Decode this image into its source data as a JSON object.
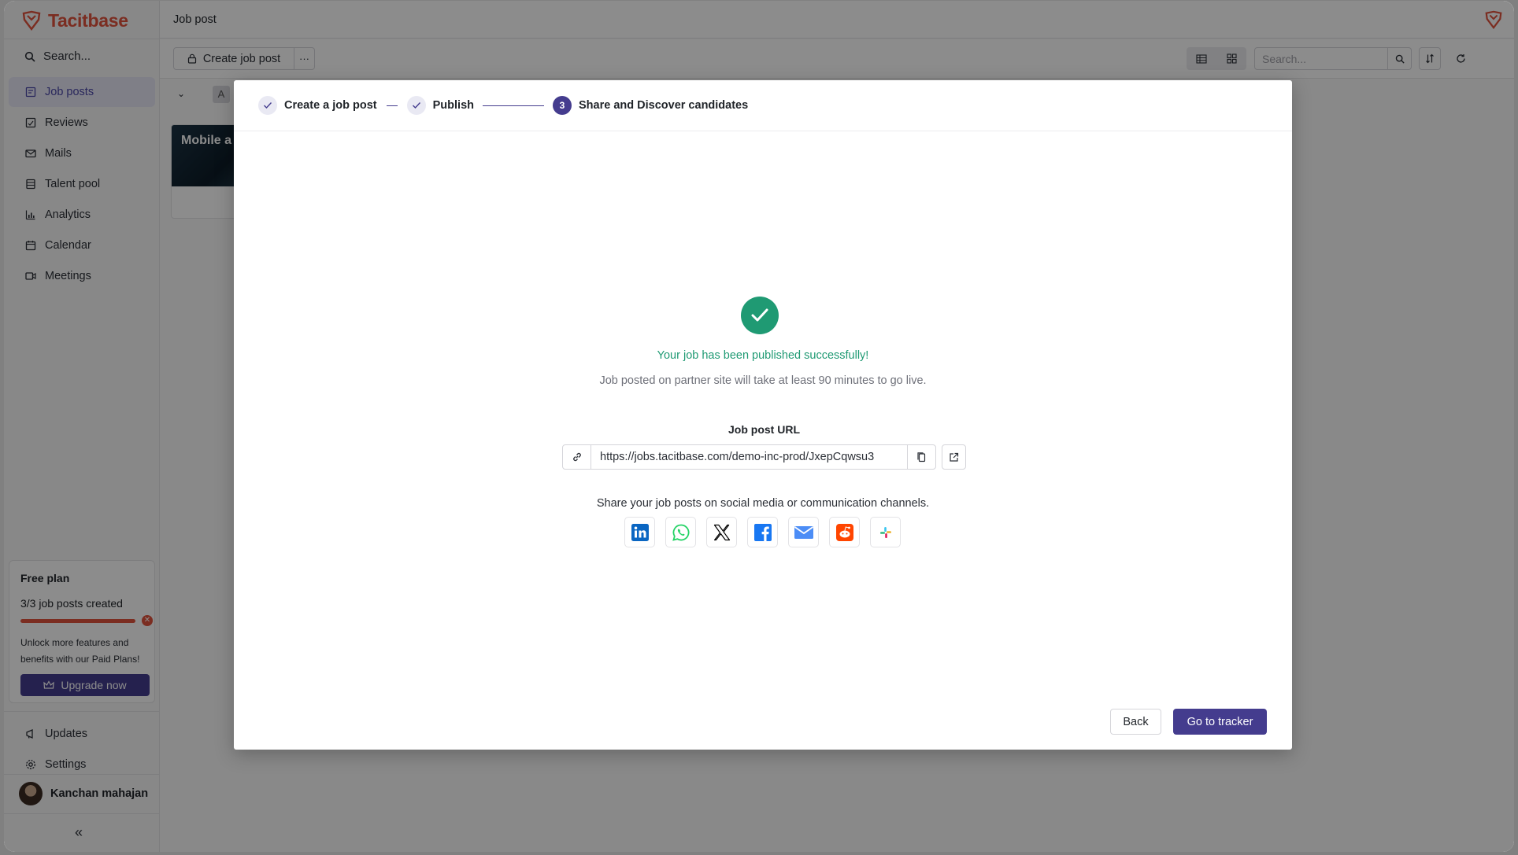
{
  "app": {
    "brand": "Tacitbase",
    "brand_color": "#e0523c",
    "accent_color": "#443c8e",
    "success_color": "#1f9a73"
  },
  "sidebar": {
    "search_label": "Search...",
    "items": [
      {
        "label": "Job posts",
        "icon": "job-posts-icon",
        "active": true
      },
      {
        "label": "Reviews",
        "icon": "reviews-icon",
        "active": false
      },
      {
        "label": "Mails",
        "icon": "mail-icon",
        "active": false
      },
      {
        "label": "Talent pool",
        "icon": "talent-pool-icon",
        "active": false
      },
      {
        "label": "Analytics",
        "icon": "analytics-icon",
        "active": false
      },
      {
        "label": "Calendar",
        "icon": "calendar-icon",
        "active": false
      },
      {
        "label": "Meetings",
        "icon": "video-icon",
        "active": false
      }
    ],
    "plan": {
      "title": "Free plan",
      "count_text": "3/3 job posts created",
      "used": 3,
      "limit": 3,
      "description": "Unlock more features and benefits with our Paid Plans!",
      "upgrade_label": "Upgrade now"
    },
    "updates_label": "Updates",
    "settings_label": "Settings",
    "user_name": "Kanchan mahajan"
  },
  "header": {
    "title": "Job post"
  },
  "toolbar": {
    "create_label": "Create job post",
    "more_label": "···",
    "search_placeholder": "Search..."
  },
  "board": {
    "group_letter": "A",
    "card_title": "Mobile a"
  },
  "modal": {
    "steps": [
      {
        "label": "Create a job post",
        "state": "done"
      },
      {
        "label": "Publish",
        "state": "done"
      },
      {
        "label": "Share and Discover candidates",
        "state": "current",
        "number": "3"
      }
    ],
    "success_title": "Your job has been published successfully!",
    "success_subtitle": "Job posted on partner site will take at least 90 minutes to go live.",
    "url_label": "Job post URL",
    "url_value": "https://jobs.tacitbase.com/demo-inc-prod/JxepCqwsu3",
    "share_text": "Share your job posts on social media or communication channels.",
    "share_channels": [
      "linkedin-icon",
      "whatsapp-icon",
      "x-icon",
      "facebook-icon",
      "email-icon",
      "reddit-icon",
      "slack-icon"
    ],
    "back_label": "Back",
    "tracker_label": "Go to tracker"
  }
}
